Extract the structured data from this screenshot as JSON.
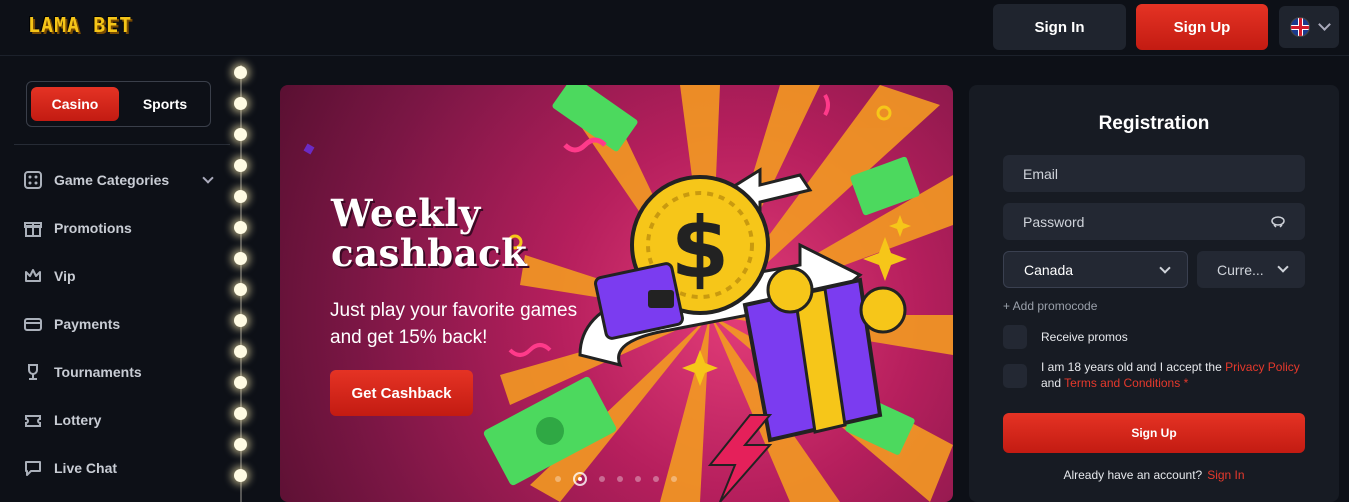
{
  "header": {
    "logo_text": "LAMA BET",
    "signin_label": "Sign In",
    "signup_label": "Sign Up",
    "language_icon": "uk-flag-icon"
  },
  "sidebar": {
    "toggle": {
      "casino_label": "Casino",
      "sports_label": "Sports"
    },
    "items": [
      {
        "label": "Game Categories",
        "icon": "dice-icon"
      },
      {
        "label": "Promotions",
        "icon": "gift-icon"
      },
      {
        "label": "Vip",
        "icon": "crown-icon"
      },
      {
        "label": "Payments",
        "icon": "card-icon"
      },
      {
        "label": "Tournaments",
        "icon": "trophy-icon"
      },
      {
        "label": "Lottery",
        "icon": "ticket-icon"
      },
      {
        "label": "Live Chat",
        "icon": "chat-icon"
      }
    ]
  },
  "banner": {
    "title_line1": "Weekly",
    "title_line2": "cashback",
    "text": "Just play your favorite games and get 15% back!",
    "cta_label": "Get Cashback",
    "slide_count": 7,
    "active_slide": 2
  },
  "registration": {
    "title": "Registration",
    "email_placeholder": "Email",
    "password_placeholder": "Password",
    "country_value": "Canada",
    "currency_placeholder": "Curre...",
    "add_promocode": "+ Add promocode",
    "receive_promos": "Receive promos",
    "terms_prefix": "I am 18 years old and I accept the",
    "privacy_link": "Privacy Policy",
    "and_text": "and",
    "terms_link": "Terms and Conditions",
    "required_mark": "*",
    "submit_label": "Sign Up",
    "have_account": "Already have an account?",
    "signin_link": "Sign In"
  },
  "colors": {
    "accent_red": "#e53324",
    "background": "#0d1017",
    "panel": "#171b23",
    "logo_yellow": "#f5c518"
  }
}
